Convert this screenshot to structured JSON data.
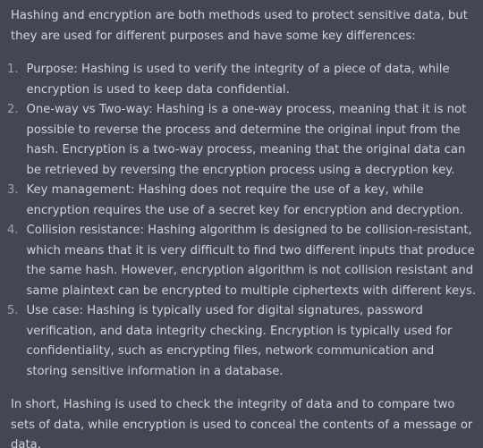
{
  "response": {
    "intro": "Hashing and encryption are both methods used to protect sensitive data, but they are used for different purposes and have some key differences:",
    "points": [
      {
        "number": "1.",
        "text": "Purpose: Hashing is used to verify the integrity of a piece of data, while encryption is used to keep data confidential."
      },
      {
        "number": "2.",
        "text": "One-way vs Two-way: Hashing is a one-way process, meaning that it is not possible to reverse the process and determine the original input from the hash. Encryption is a two-way process, meaning that the original data can be retrieved by reversing the encryption process using a decryption key."
      },
      {
        "number": "3.",
        "text": "Key management: Hashing does not require the use of a key, while encryption requires the use of a secret key for encryption and decryption."
      },
      {
        "number": "4.",
        "text": "Collision resistance: Hashing algorithm is designed to be collision-resistant, which means that it is very difficult to find two different inputs that produce the same hash. However, encryption algorithm is not collision resistant and same plaintext can be encrypted to multiple ciphertexts with different keys."
      },
      {
        "number": "5.",
        "text": "Use case: Hashing is typically used for digital signatures, password verification, and data integrity checking. Encryption is typically used for confidentiality, such as encrypting files, network communication and storing sensitive information in a database."
      }
    ],
    "conclusion": "In short, Hashing is used to check the integrity of data and to compare two sets of data, while encryption is used to conceal the contents of a message or data."
  },
  "colors": {
    "background": "#444654",
    "text": "#d1d5db",
    "list_number": "#9ca3af"
  }
}
